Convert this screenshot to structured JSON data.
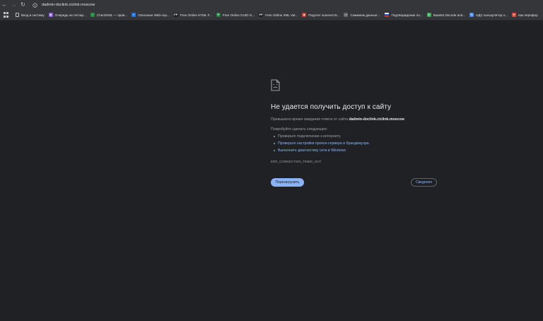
{
  "toolbar": {
    "back_icon": "arrow-left-icon",
    "forward_icon": "arrow-right-icon",
    "reload_icon": "reload-icon",
    "url": "dadmin-doclink.ciclink.moscow"
  },
  "bookmarks": [
    {
      "label": "Вход в систему",
      "icon": "page-icon",
      "color": "#3c4043",
      "glyph": ""
    },
    {
      "label": "Очередь на тестир...",
      "icon": "vs-icon",
      "color": "#8b5cf6",
      "glyph": "◆"
    },
    {
      "label": "CheckXML — пров...",
      "icon": "checkxml-icon",
      "color": "#1e8e3e",
      "glyph": "✓"
    },
    {
      "label": "Описание Web-сер...",
      "icon": "arrow-icon",
      "color": "#1a73e8",
      "glyph": "»"
    },
    {
      "label": "Free Online HTML F...",
      "icon": "ff-icon",
      "color": "#202124",
      "glyph": "FF"
    },
    {
      "label": "Free Online GUID G...",
      "icon": "guid-icon",
      "color": "#188038",
      "glyph": "⚙"
    },
    {
      "label": "Free Online XML Val...",
      "icon": "ff-icon",
      "color": "#202124",
      "glyph": "FF"
    },
    {
      "label": "Подсчет количеств...",
      "icon": "counter-icon",
      "color": "#d93025",
      "glyph": "◉"
    },
    {
      "label": "Сжимаем данные:...",
      "icon": "compress-icon",
      "color": "#5f6368",
      "glyph": "▭"
    },
    {
      "label": "Подтверждение по...",
      "icon": "flag-ru-icon",
      "color": "#ffffff",
      "glyph": ""
    },
    {
      "label": "Base64 Decode and...",
      "icon": "base64-icon",
      "color": "#34a853",
      "glyph": "b"
    },
    {
      "label": "НДС калькулятор о...",
      "icon": "calc-icon",
      "color": "#4285f4",
      "glyph": "%"
    },
    {
      "label": "Как перефор",
      "icon": "heart-icon",
      "color": "#ea4335",
      "glyph": "♥"
    }
  ],
  "error_page": {
    "heading": "Не удается получить доступ к сайту",
    "description_prefix": "Превышено время ожидания ответа от сайта ",
    "site": "dadmin-doclink.ciclink.moscow",
    "description_suffix": ".",
    "suggest_title": "Попробуйте сделать следующее:",
    "suggestions": [
      {
        "text": "Проверьте подключение к интернету.",
        "link": false
      },
      {
        "text": "Проверьте настройки прокси-сервера и брандмауэра.",
        "link": true
      },
      {
        "text": "Выполните диагностику сети в Windows",
        "link": true
      }
    ],
    "error_code": "ERR_CONNECTION_TIMED_OUT",
    "reload_label": "Перезагрузить",
    "details_label": "Сведения"
  },
  "colors": {
    "background": "#202124",
    "accent": "#8ab4f8",
    "toolbar": "#35363a"
  }
}
